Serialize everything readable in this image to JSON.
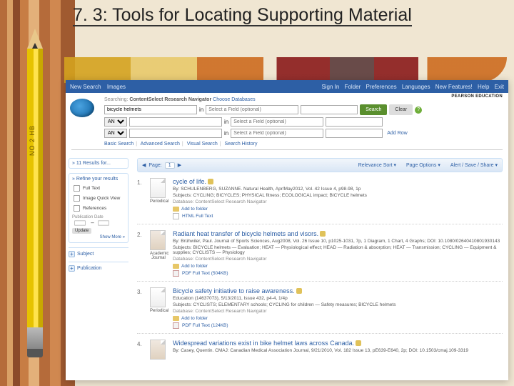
{
  "slideTitle": "7. 3: Tools for Locating Supporting Material",
  "pencilLabel": "NO 2 HB",
  "topbar": {
    "left": [
      "New Search",
      "Images"
    ],
    "right": [
      "Sign In",
      "Folder",
      "Preferences",
      "Languages",
      "New Features!",
      "Help",
      "Exit"
    ]
  },
  "brand": "PEARSON EDUCATION",
  "searchHeader": {
    "searchingLabel": "Searching:",
    "dbName": "ContentSelect Research Navigator",
    "chooseLink": "Choose Databases"
  },
  "search": {
    "rows": [
      {
        "op": "",
        "q": "bicycle helmets",
        "fieldPlaceholder": "Select a Field (optional)"
      },
      {
        "op": "AND",
        "q": "",
        "fieldPlaceholder": "Select a Field (optional)"
      },
      {
        "op": "AND",
        "q": "",
        "fieldPlaceholder": "Select a Field (optional)"
      }
    ],
    "searchBtn": "Search",
    "clearBtn": "Clear",
    "scopePlaceholder": "",
    "addRow": "Add Row"
  },
  "searchTabs": [
    "Basic Search",
    "Advanced Search",
    "Visual Search",
    "Search History"
  ],
  "side": {
    "count": "11 Results for...",
    "refine": "Refine your results",
    "filters": [
      "Full Text",
      "Image Quick View",
      "References"
    ],
    "pubdate": "Publication Date",
    "update": "Update",
    "showmore": "Show More »",
    "facets": [
      "Subject",
      "Publication"
    ]
  },
  "pager": {
    "pageLabel": "Page:",
    "page": "1",
    "right": [
      "Relevance Sort",
      "Page Options",
      "Alert / Save / Share"
    ]
  },
  "thumbCaps": {
    "periodical": "Periodical",
    "academic": "Academic Journal"
  },
  "results": [
    {
      "title": "cycle of life.",
      "thumb": "periodical",
      "meta": "By: SCHULENBERG, SUZANNE. Natural Health, Apr/May2012, Vol. 42 Issue 4, p98-98, 1p",
      "subj": "Subjects: CYCLING; BICYCLES; PHYSICAL fitness; ECOLOGICAL impact; BICYCLE helmets",
      "db": "Database: ContentSelect Research Navigator",
      "addFolder": "Add to folder",
      "fulltext": {
        "kind": "html",
        "label": "HTML Full Text"
      }
    },
    {
      "title": "Radiant heat transfer of bicycle helmets and visors.",
      "thumb": "academic",
      "meta": "By: Brühwiler, Paul. Journal of Sports Sciences, Aug2008, Vol. 26 Issue 10, p1025-1031, 7p, 1 Diagram, 1 Chart, 4 Graphs; DOI: 10.1080/02640410801930143",
      "subj": "Subjects: BICYCLE helmets — Evaluation; HEAT — Physiological effect; HEAD — Radiation & absorption; HEAT — Transmission; CYCLING — Equipment & supplies; CYCLISTS — Physiology",
      "db": "Database: ContentSelect Research Navigator",
      "addFolder": "Add to folder",
      "fulltext": {
        "kind": "pdf",
        "label": "PDF Full Text (504KB)"
      }
    },
    {
      "title": "Bicycle safety initiative to raise awareness.",
      "thumb": "periodical",
      "meta": "Education (14637073), 5/13/2011, Issue 432, p4-4, 1/4p",
      "subj": "Subjects: CYCLISTS; ELEMENTARY schools; CYCLING for children — Safety measures; BICYCLE helmets",
      "db": "Database: ContentSelect Research Navigator",
      "addFolder": "Add to folder",
      "fulltext": {
        "kind": "pdf",
        "label": "PDF Full Text (124KB)"
      }
    },
    {
      "title": "Widespread variations exist in bike helmet laws across Canada.",
      "thumb": "academic",
      "meta": "By: Casey, Quentin. CMAJ: Canadian Medical Association Journal, 9/21/2010, Vol. 182 Issue 13, pE639-E640, 2p; DOI: 10.1503/cmaj.109-3319",
      "subj": "",
      "db": "",
      "addFolder": "",
      "fulltext": null
    }
  ]
}
